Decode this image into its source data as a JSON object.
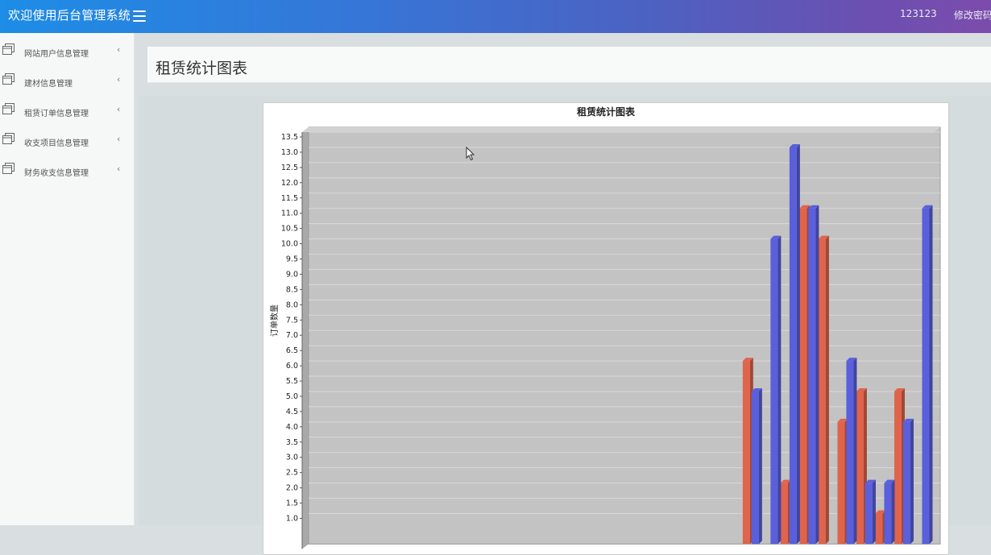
{
  "header": {
    "app_title": "欢迎使用后台管理系统",
    "username": "123123",
    "change_password": "修改密码"
  },
  "sidebar": {
    "items": [
      {
        "label": "网站用户信息管理"
      },
      {
        "label": "建材信息管理"
      },
      {
        "label": "租赁订单信息管理"
      },
      {
        "label": "收支项目信息管理"
      },
      {
        "label": "财务收支信息管理"
      }
    ]
  },
  "page": {
    "title": "租赁统计图表"
  },
  "colors": {
    "series_a": "#e0644c",
    "series_b": "#5a5fdc",
    "plot_bg": "#c3c3c3"
  },
  "chart_data": {
    "type": "bar",
    "title": "租赁统计图表",
    "ylabel": "订单数量",
    "xlabel": "",
    "ylim": [
      0,
      13.5
    ],
    "y_ticks": [
      "1.0",
      "1.5",
      "2.0",
      "2.5",
      "3.0",
      "3.5",
      "4.0",
      "4.5",
      "5.0",
      "5.5",
      "6.0",
      "6.5",
      "7.0",
      "7.5",
      "8.0",
      "8.5",
      "9.0",
      "9.5",
      "10.0",
      "10.5",
      "11.0",
      "11.5",
      "12.0",
      "12.5",
      "13.0",
      "13.5"
    ],
    "series": [
      {
        "color": "#e0644c",
        "values": [
          0,
          0,
          0,
          0,
          0,
          0,
          0,
          0,
          0,
          0,
          0,
          0,
          0,
          0,
          0,
          0,
          0,
          0,
          0,
          0,
          0,
          0,
          0,
          6,
          0,
          2,
          11,
          10,
          4,
          5,
          1,
          5
        ]
      },
      {
        "color": "#5a5fdc",
        "values": [
          0,
          0,
          0,
          0,
          0,
          0,
          0,
          0,
          0,
          0,
          0,
          0,
          0,
          0,
          0,
          0,
          0,
          0,
          0,
          0,
          0,
          0,
          0,
          5,
          10,
          13,
          11,
          0,
          6,
          2,
          2,
          4,
          11
        ]
      }
    ]
  }
}
